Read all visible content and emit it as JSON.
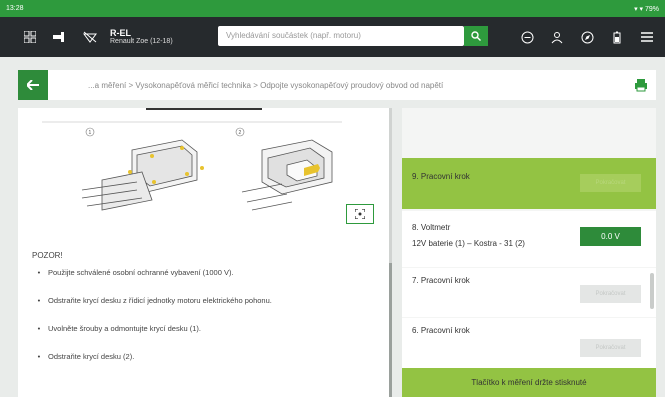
{
  "statusbar": {
    "time": "13:28",
    "right": "▾ ▾ 79%"
  },
  "topbar": {
    "vehicle_code": "R-EL",
    "vehicle_model": "Renault Zoe (12-18)",
    "search_placeholder": "Vyhledávání součástek (např. motoru)",
    "icons": [
      "grid-icon",
      "parts-icon",
      "no-signal-icon",
      "search-icon",
      "minus-circle-icon",
      "person-icon",
      "compass-icon",
      "battery-icon",
      "menu-icon"
    ]
  },
  "breadcrumb": {
    "text": "...a měření > Vysokonapěťová měřicí technika > Odpojte vysokonapěťový proudový obvod od napětí"
  },
  "figure": {
    "callouts": [
      "1",
      "2"
    ]
  },
  "warning": {
    "title": "POZOR!",
    "items": [
      "Použijte schválené osobní ochranné vybavení (1000 V).",
      "Odstraňte krycí desku z řídicí jednotky motoru elektrického pohonu.",
      "Uvolněte šrouby a odmontujte krycí desku (1).",
      "Odstraňte krycí desku (2)."
    ]
  },
  "steps": {
    "step9": {
      "label": "9. Pracovní krok",
      "button": "Pokračovat"
    },
    "step8": {
      "label": "8. Voltmetr",
      "sublabel": "12V baterie (1) – Kostra - 31 (2)",
      "value": "0.0 V"
    },
    "step7": {
      "label": "7. Pracovní krok",
      "button": "Pokračovat"
    },
    "step6": {
      "label": "6. Pracovní krok",
      "button": "Pokračovat"
    }
  },
  "hold_button": "Tlačítko k měření držte stisknuté",
  "colors": {
    "green": "#2e9a3d",
    "dark_green": "#2e8b3a",
    "lime": "#93c343",
    "topbar": "#262a2d"
  }
}
